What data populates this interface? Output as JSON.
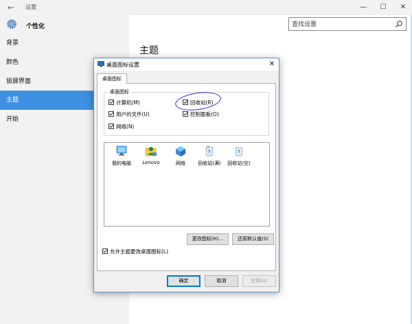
{
  "window": {
    "title": "设置",
    "controls": {
      "minimize": "—",
      "maximize": "☐",
      "close": "✕"
    }
  },
  "sidebar": {
    "home_label": "个性化",
    "items": [
      {
        "label": "背景"
      },
      {
        "label": "颜色"
      },
      {
        "label": "锁屏界面"
      },
      {
        "label": "主题",
        "active": true
      },
      {
        "label": "开始"
      }
    ]
  },
  "search": {
    "placeholder": "查找设置"
  },
  "main": {
    "title": "主题"
  },
  "dialog": {
    "title": "桌面图标设置",
    "close": "✕",
    "tab": "桌面图标",
    "group_label": "桌面图标",
    "checkboxes": [
      {
        "label": "计算机(M)",
        "checked": true
      },
      {
        "label": "回收站(R)",
        "checked": true
      },
      {
        "label": "用户的文件(U)",
        "checked": true
      },
      {
        "label": "控制面板(O)",
        "checked": true
      },
      {
        "label": "网络(N)",
        "checked": true
      }
    ],
    "icons": [
      {
        "label": "我的电脑",
        "icon": "computer-icon"
      },
      {
        "label": "Lenovo",
        "icon": "user-folder-icon"
      },
      {
        "label": "网络",
        "icon": "network-icon"
      },
      {
        "label": "回收站(满)",
        "icon": "recycle-bin-full-icon"
      },
      {
        "label": "回收站(空)",
        "icon": "recycle-bin-empty-icon"
      }
    ],
    "change_icon_button": "更改图标(H)...",
    "restore_default_button": "还原默认值(S)",
    "allow_themes": {
      "label": "允许主题更改桌面图标(L)",
      "checked": true
    },
    "ok_button": "确定",
    "cancel_button": "取消",
    "apply_button": "应用(A)"
  },
  "colors": {
    "accent": "#3f90e0",
    "annotation_circle": "#2e2ec8"
  }
}
